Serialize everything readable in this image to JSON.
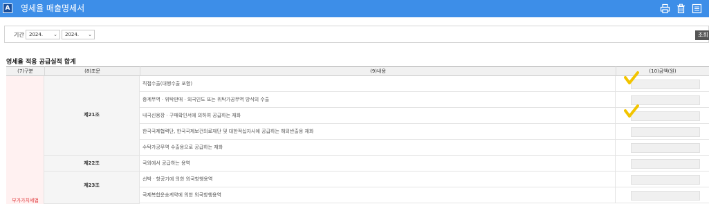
{
  "header": {
    "badge": "A",
    "title": "영세율 매출명세서",
    "icons": [
      "print-icon",
      "trash-icon",
      "export-icon"
    ]
  },
  "filter": {
    "label": "기간",
    "from_value": "2024.",
    "to_value": "2024.",
    "separator": "~",
    "search_label": "조회"
  },
  "section_title": "영세율 적용 공급실적 합계",
  "table": {
    "columns": [
      "(7)구분",
      "(8)조문",
      "(9)내용",
      "(10)금액(원)"
    ],
    "category": "부가가치세법",
    "groups": [
      {
        "article": "제21조",
        "rows": [
          "직접수출(대행수출 포함)",
          "중계무역 · 위탁판매 · 외국인도 또는 위탁가공무역 방식의 수출",
          "내국신용장 · 구매확인서에 의하여 공급하는 재화",
          "한국국제협력단, 한국국제보건의료재단 및 대한적십자사에 공급하는 해외반출용 재화",
          "수탁가공무역 수출용으로 공급하는 재화"
        ]
      },
      {
        "article": "제22조",
        "rows": [
          "국외에서 공급하는 용역"
        ]
      },
      {
        "article": "제23조",
        "rows": [
          "선박 · 항공기에 의한 외국항행용역",
          "국제복합운송계약에 의한 외국항행용역"
        ]
      }
    ]
  },
  "colors": {
    "titlebar": "#3d8ee8",
    "category_bg": "#fff1f1",
    "category_text": "#e0373a",
    "checkmark": "#f2c400"
  }
}
